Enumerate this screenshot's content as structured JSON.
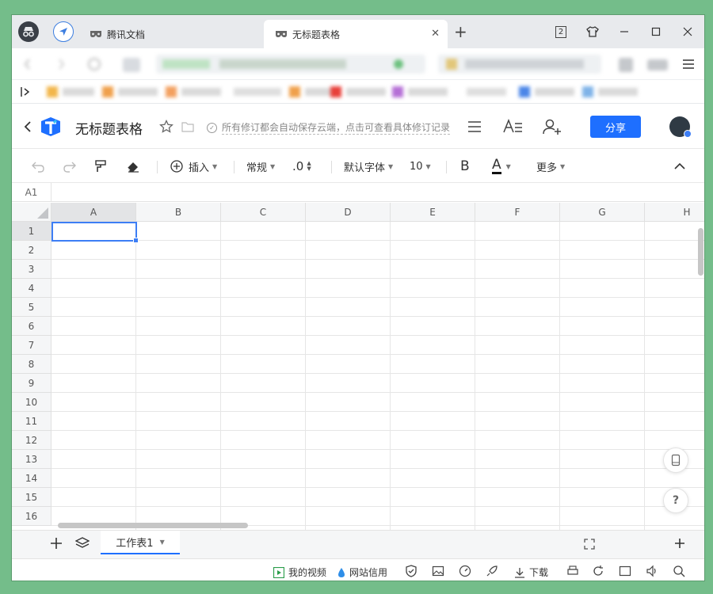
{
  "browser": {
    "tabs": [
      {
        "title": "腾讯文档",
        "active": false
      },
      {
        "title": "无标题表格",
        "active": true
      }
    ],
    "tab_counter": "2"
  },
  "doc": {
    "title": "无标题表格",
    "status": "所有修订都会自动保存云端，点击可查看具体修订记录",
    "share_label": "分享"
  },
  "toolbar": {
    "insert": "插入",
    "format": "常规",
    "decimal": ".0",
    "font": "默认字体",
    "font_size": "10",
    "bold": "B",
    "font_color": "A",
    "more": "更多"
  },
  "name_box": "A1",
  "grid": {
    "columns": [
      "A",
      "B",
      "C",
      "D",
      "E",
      "F",
      "G",
      "H"
    ],
    "rows": [
      "1",
      "2",
      "3",
      "4",
      "5",
      "6",
      "7",
      "8",
      "9",
      "10",
      "11",
      "12",
      "13",
      "14",
      "15",
      "16"
    ],
    "selected_column": "A",
    "selected_row": "1"
  },
  "sheets": [
    {
      "name": "工作表1",
      "active": true
    }
  ],
  "help_label": "?",
  "status_bar": {
    "my_video": "我的视频",
    "site_credit": "网站信用",
    "download": "下载"
  },
  "colors": {
    "accent": "#1e6fff",
    "selection": "#3d7ef5",
    "desktop": "#74bd8a"
  }
}
